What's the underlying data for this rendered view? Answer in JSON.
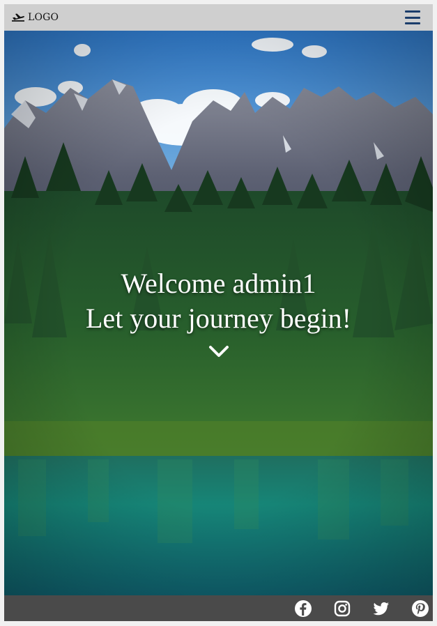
{
  "header": {
    "logo_text": "LOGO",
    "logo_icon": "airplane-icon",
    "menu_icon": "hamburger-menu-icon",
    "bg_color": "#cfcfcf",
    "menu_color": "#1b3d6b"
  },
  "hero": {
    "welcome_text": "Welcome admin1",
    "tagline": "Let your journey begin!",
    "scroll_icon": "chevron-down-icon"
  },
  "footer": {
    "bg_color": "#4a4a4a",
    "social_links": [
      {
        "icon": "facebook-icon"
      },
      {
        "icon": "instagram-icon"
      },
      {
        "icon": "twitter-icon"
      },
      {
        "icon": "pinterest-icon"
      }
    ]
  }
}
